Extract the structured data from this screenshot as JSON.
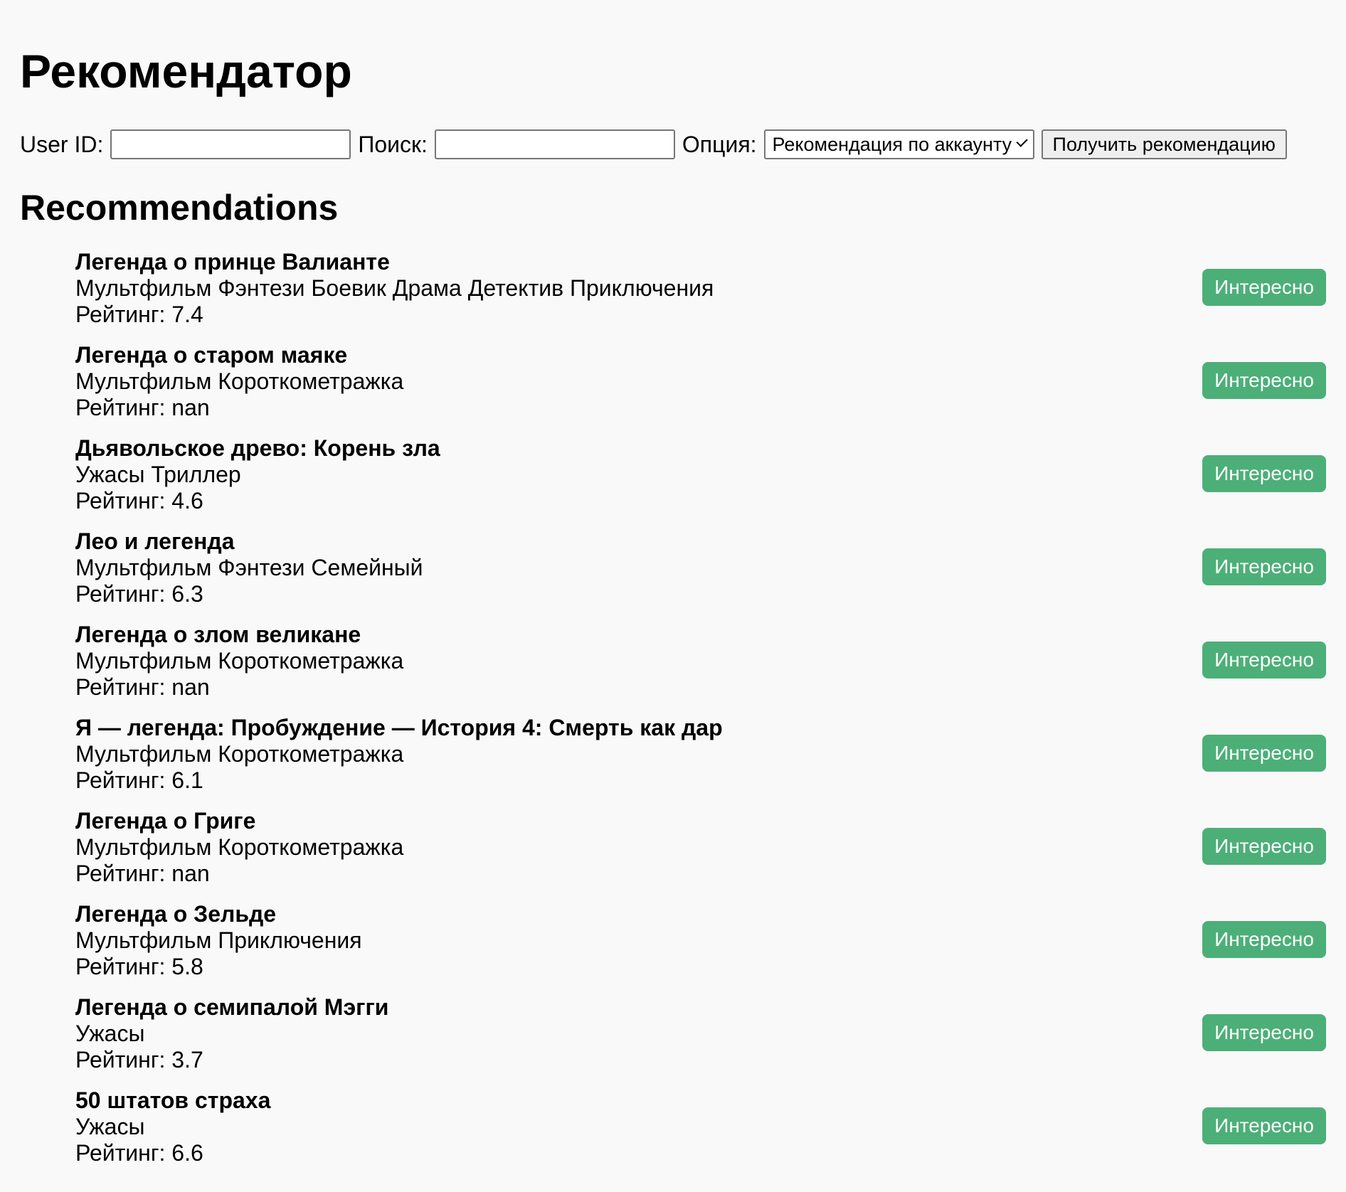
{
  "page": {
    "title": "Рекомендатор",
    "section_heading": "Recommendations"
  },
  "form": {
    "user_id_label": "User ID:",
    "user_id_value": "",
    "search_label": "Поиск:",
    "search_value": "",
    "option_label": "Опция:",
    "option_selected": "Рекомендация по аккаунту",
    "submit_label": "Получить рекомендацию"
  },
  "rating_prefix": "Рейтинг: ",
  "interest_label": "Интересно",
  "colors": {
    "accent_green": "#4caf78",
    "background": "#f9f9f9"
  },
  "recommendations": [
    {
      "title": "Легенда о принце Валианте",
      "genres": "Мультфильм Фэнтези Боевик Драма Детектив Приключения",
      "rating": "Рейтинг: 7.4"
    },
    {
      "title": "Легенда о старом маяке",
      "genres": "Мультфильм Короткометражка",
      "rating": "Рейтинг: nan"
    },
    {
      "title": "Дьявольское древо: Корень зла",
      "genres": "Ужасы Триллер",
      "rating": "Рейтинг: 4.6"
    },
    {
      "title": "Лео и легенда",
      "genres": "Мультфильм Фэнтези Семейный",
      "rating": "Рейтинг: 6.3"
    },
    {
      "title": "Легенда о злом великане",
      "genres": "Мультфильм Короткометражка",
      "rating": "Рейтинг: nan"
    },
    {
      "title": "Я — легенда: Пробуждение — История 4: Смерть как дар",
      "genres": "Мультфильм Короткометражка",
      "rating": "Рейтинг: 6.1"
    },
    {
      "title": "Легенда о Григе",
      "genres": "Мультфильм Короткометражка",
      "rating": "Рейтинг: nan"
    },
    {
      "title": "Легенда о Зельде",
      "genres": "Мультфильм Приключения",
      "rating": "Рейтинг: 5.8"
    },
    {
      "title": "Легенда о семипалой Мэгги",
      "genres": "Ужасы",
      "rating": "Рейтинг: 3.7"
    },
    {
      "title": "50 штатов страха",
      "genres": "Ужасы",
      "rating": "Рейтинг: 6.6"
    }
  ]
}
